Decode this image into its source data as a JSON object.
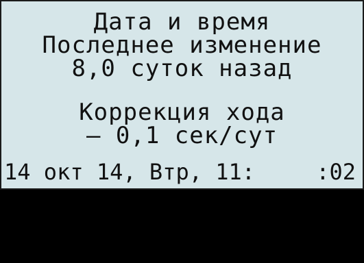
{
  "display": {
    "title": "Дата и время",
    "last_change_label": "Последнее изменение",
    "last_change_value": "8,0 суток назад",
    "correction_label": "Коррекция хода",
    "correction_value": "– 0,1 сек/сут",
    "status_date_time": "14 окт 14, Втр, 11:",
    "status_seconds": ":02"
  },
  "colors": {
    "lcd_background": "#d6e6e9",
    "lcd_text": "#111111",
    "frame": "#000000"
  }
}
